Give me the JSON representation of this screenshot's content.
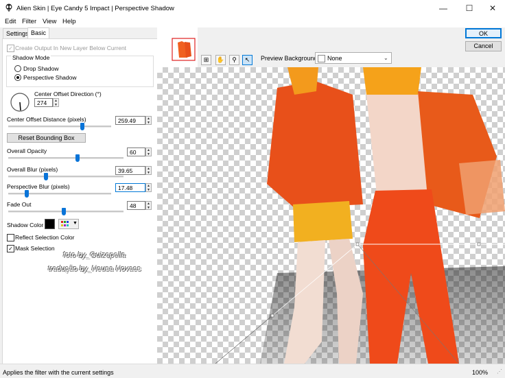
{
  "window": {
    "title": "Alien Skin | Eye Candy 5 Impact | Perspective Shadow",
    "minimize": "—",
    "maximize": "☐",
    "close": "✕"
  },
  "menu": [
    "Edit",
    "Filter",
    "View",
    "Help"
  ],
  "tabs": [
    {
      "label": "Settings",
      "active": false
    },
    {
      "label": "Basic",
      "active": true
    }
  ],
  "basic": {
    "create_output_label": "Create Output In New Layer Below Current",
    "create_output_checked": true,
    "shadow_mode_label": "Shadow Mode",
    "drop_shadow_label": "Drop Shadow",
    "perspective_shadow_label": "Perspective Shadow",
    "selected_mode": "Perspective Shadow",
    "center_offset_direction_label": "Center Offset Direction (°)",
    "center_offset_direction_value": "274",
    "center_offset_distance_label": "Center Offset Distance (pixels)",
    "center_offset_distance_value": "259.49",
    "center_offset_distance_level": 0.72,
    "reset_bounding_box_label": "Reset Bounding Box",
    "overall_opacity_label": "Overall Opacity",
    "overall_opacity_value": "60",
    "overall_opacity_level": 0.6,
    "overall_blur_label": "Overall Blur (pixels)",
    "overall_blur_value": "39.65",
    "overall_blur_level": 0.33,
    "perspective_blur_label": "Perspective Blur (pixels)",
    "perspective_blur_value": "17.48",
    "perspective_blur_level": 0.18,
    "fade_out_label": "Fade Out",
    "fade_out_value": "48",
    "fade_out_level": 0.48,
    "shadow_color_label": "Shadow Color",
    "shadow_color": "#000000",
    "reflect_selection_label": "Reflect Selection Color",
    "reflect_selection_checked": false,
    "mask_selection_label": "Mask Selection",
    "mask_selection_checked": true
  },
  "watermark": {
    "line1": "foto by_Guizepella",
    "line2": "tradução by_Neusa Novaes"
  },
  "preview": {
    "background_label": "Preview Background",
    "background_value": "None"
  },
  "buttons": {
    "ok": "OK",
    "cancel": "Cancel"
  },
  "status": {
    "text": "Applies the filter with the current settings",
    "zoom": "100%"
  },
  "icons": {
    "app": "alien-skin-logo-icon",
    "color_picker": "color-palette-icon"
  },
  "colors": {
    "accent": "#0a74d8",
    "ok_border": "#0078d7",
    "orange": "#e8501a"
  }
}
